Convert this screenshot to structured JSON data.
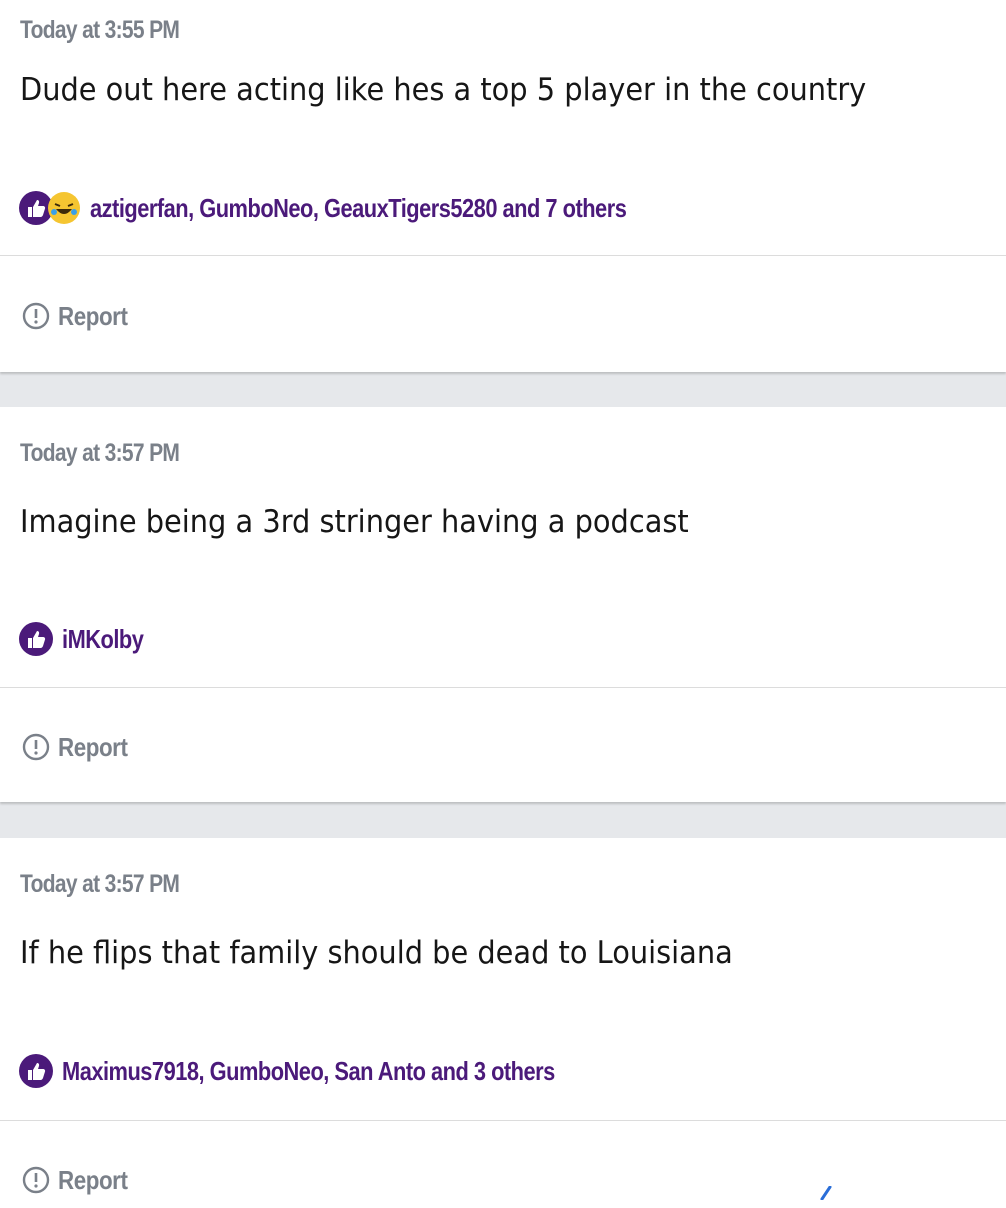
{
  "posts": [
    {
      "timestamp": "Today at 3:55 PM",
      "message": "Dude out here acting like hes a top 5 player in the country",
      "reactions": {
        "icons": [
          "like-icon",
          "laugh-icon"
        ],
        "users": "aztigerfan, GumboNeo, GeauxTigers5280 and 7 others"
      },
      "report_label": "Report"
    },
    {
      "timestamp": "Today at 3:57 PM",
      "message": "Imagine being a 3rd stringer having a podcast",
      "reactions": {
        "icons": [
          "like-icon"
        ],
        "users": "iMKolby"
      },
      "report_label": "Report"
    },
    {
      "timestamp": "Today at 3:57 PM",
      "message": "If he flips that family should be dead to Louisiana",
      "reactions": {
        "icons": [
          "like-icon"
        ],
        "users": "Maximus7918, GumboNeo, San Anto and 3 others"
      },
      "report_label": "Report"
    }
  ],
  "colors": {
    "accent": "#4b1a7a",
    "muted_text": "#7a8089",
    "body_text": "#161616",
    "page_bg": "#e6e8eb",
    "card_bg": "#ffffff"
  }
}
